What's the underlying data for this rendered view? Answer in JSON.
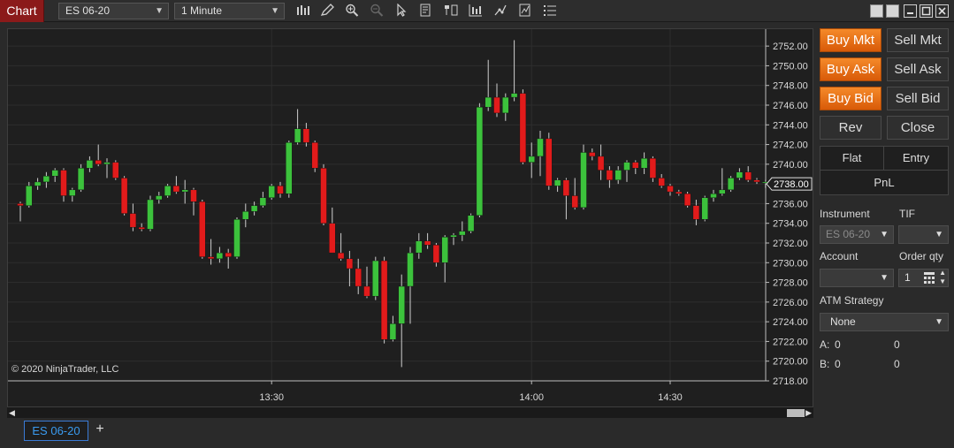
{
  "toolbar": {
    "tab_label": "Chart",
    "instrument": "ES 06-20",
    "interval": "1 Minute",
    "tools": [
      "bar-type-icon",
      "drawing-pencil-icon",
      "zoom-in-icon",
      "zoom-out-icon",
      "pointer-icon",
      "data-box-icon",
      "indicators-icon",
      "strategies-icon",
      "properties-icon",
      "chart-trader-icon"
    ]
  },
  "chart": {
    "copyright": "© 2020 NinjaTrader, LLC",
    "current_price_label": "2738.00",
    "colors": {
      "up": "#3cc23c",
      "down": "#e21b1b",
      "wick": "#cfcfcf",
      "grid": "#2e2e2e",
      "bg": "#1f1f1f"
    }
  },
  "chart_data": {
    "type": "candlestick",
    "title": "",
    "xlabel": "",
    "ylabel": "",
    "ylim": [
      2718,
      2753
    ],
    "y_ticks": [
      "2752.00",
      "2750.00",
      "2748.00",
      "2746.00",
      "2744.00",
      "2742.00",
      "2740.00",
      "2738.00",
      "2736.00",
      "2734.00",
      "2732.00",
      "2730.00",
      "2728.00",
      "2726.00",
      "2724.00",
      "2722.00",
      "2720.00",
      "2718.00"
    ],
    "x_ticks": [
      {
        "label": "13:30",
        "index": 29
      },
      {
        "label": "14:00",
        "index": 59
      },
      {
        "label": "14:30",
        "index": 75
      }
    ],
    "candles": [
      [
        2736.0,
        2736.2,
        2734.2,
        2735.8
      ],
      [
        2735.8,
        2738.2,
        2735.6,
        2737.8
      ],
      [
        2737.8,
        2738.6,
        2737.4,
        2738.2
      ],
      [
        2738.2,
        2739.2,
        2737.6,
        2738.8
      ],
      [
        2738.8,
        2739.6,
        2738.2,
        2739.4
      ],
      [
        2739.4,
        2739.6,
        2736.2,
        2736.8
      ],
      [
        2736.8,
        2737.6,
        2736.2,
        2737.4
      ],
      [
        2737.4,
        2740.0,
        2737.2,
        2739.6
      ],
      [
        2739.6,
        2740.8,
        2739.2,
        2740.4
      ],
      [
        2740.4,
        2742.0,
        2739.8,
        2740.0
      ],
      [
        2740.0,
        2740.6,
        2738.6,
        2740.2
      ],
      [
        2740.2,
        2740.4,
        2738.4,
        2738.6
      ],
      [
        2738.6,
        2738.8,
        2734.8,
        2735.0
      ],
      [
        2735.0,
        2736.0,
        2733.2,
        2733.6
      ],
      [
        2733.6,
        2734.0,
        2733.2,
        2733.4
      ],
      [
        2733.4,
        2736.8,
        2733.2,
        2736.4
      ],
      [
        2736.4,
        2737.2,
        2736.0,
        2736.8
      ],
      [
        2736.8,
        2738.0,
        2736.6,
        2737.8
      ],
      [
        2737.8,
        2738.8,
        2737.0,
        2737.2
      ],
      [
        2737.2,
        2738.4,
        2736.0,
        2737.4
      ],
      [
        2737.4,
        2737.6,
        2734.8,
        2736.2
      ],
      [
        2736.2,
        2736.4,
        2730.4,
        2730.6
      ],
      [
        2730.6,
        2732.4,
        2729.8,
        2730.4
      ],
      [
        2730.4,
        2731.6,
        2730.0,
        2731.0
      ],
      [
        2731.0,
        2731.4,
        2729.4,
        2730.6
      ],
      [
        2730.6,
        2734.6,
        2730.4,
        2734.4
      ],
      [
        2734.4,
        2736.0,
        2733.6,
        2735.2
      ],
      [
        2735.2,
        2736.2,
        2734.8,
        2735.8
      ],
      [
        2735.8,
        2737.2,
        2735.6,
        2736.6
      ],
      [
        2736.6,
        2738.0,
        2736.4,
        2737.8
      ],
      [
        2737.8,
        2738.2,
        2736.6,
        2737.0
      ],
      [
        2737.0,
        2742.4,
        2736.6,
        2742.2
      ],
      [
        2742.2,
        2745.6,
        2742.0,
        2743.6
      ],
      [
        2743.6,
        2744.2,
        2741.8,
        2742.2
      ],
      [
        2742.2,
        2742.4,
        2739.2,
        2739.6
      ],
      [
        2739.6,
        2740.0,
        2733.8,
        2734.0
      ],
      [
        2734.0,
        2735.6,
        2731.0,
        2731.0
      ],
      [
        2731.0,
        2733.0,
        2730.2,
        2730.4
      ],
      [
        2730.4,
        2731.2,
        2727.6,
        2729.4
      ],
      [
        2729.4,
        2730.4,
        2726.8,
        2727.6
      ],
      [
        2727.6,
        2729.6,
        2726.4,
        2726.6
      ],
      [
        2726.6,
        2730.6,
        2726.2,
        2730.2
      ],
      [
        2730.2,
        2730.6,
        2721.8,
        2722.2
      ],
      [
        2722.2,
        2724.6,
        2722.0,
        2723.8
      ],
      [
        2723.8,
        2728.8,
        2719.4,
        2727.6
      ],
      [
        2727.6,
        2731.6,
        2723.8,
        2731.0
      ],
      [
        2731.0,
        2733.0,
        2730.4,
        2732.2
      ],
      [
        2732.2,
        2733.0,
        2731.4,
        2731.8
      ],
      [
        2731.8,
        2732.0,
        2729.6,
        2730.0
      ],
      [
        2730.0,
        2732.8,
        2728.0,
        2732.6
      ],
      [
        2732.6,
        2733.0,
        2731.8,
        2732.8
      ],
      [
        2732.8,
        2734.2,
        2732.2,
        2733.2
      ],
      [
        2733.2,
        2735.0,
        2733.0,
        2734.8
      ],
      [
        2734.8,
        2746.2,
        2734.6,
        2745.8
      ],
      [
        2745.8,
        2750.6,
        2745.4,
        2746.8
      ],
      [
        2746.8,
        2748.2,
        2744.8,
        2745.2
      ],
      [
        2745.2,
        2747.2,
        2744.4,
        2746.8
      ],
      [
        2746.8,
        2752.6,
        2746.4,
        2747.2
      ],
      [
        2747.2,
        2747.6,
        2740.0,
        2740.2
      ],
      [
        2740.2,
        2742.2,
        2738.6,
        2740.8
      ],
      [
        2740.8,
        2743.4,
        2738.8,
        2742.6
      ],
      [
        2742.6,
        2743.2,
        2737.4,
        2737.8
      ],
      [
        2737.8,
        2738.6,
        2737.2,
        2738.4
      ],
      [
        2738.4,
        2738.6,
        2734.4,
        2736.8
      ],
      [
        2736.8,
        2738.6,
        2735.4,
        2735.6
      ],
      [
        2735.6,
        2742.0,
        2735.4,
        2741.2
      ],
      [
        2741.2,
        2741.6,
        2740.4,
        2740.8
      ],
      [
        2740.8,
        2742.0,
        2738.4,
        2739.4
      ],
      [
        2739.4,
        2739.8,
        2737.6,
        2738.4
      ],
      [
        2738.4,
        2739.8,
        2738.0,
        2739.4
      ],
      [
        2739.4,
        2740.4,
        2738.2,
        2740.2
      ],
      [
        2740.2,
        2740.4,
        2739.0,
        2739.6
      ],
      [
        2739.6,
        2741.2,
        2739.0,
        2740.6
      ],
      [
        2740.6,
        2740.8,
        2738.2,
        2738.6
      ],
      [
        2738.6,
        2739.0,
        2737.6,
        2737.8
      ],
      [
        2737.8,
        2738.0,
        2736.8,
        2737.2
      ],
      [
        2737.2,
        2737.4,
        2736.8,
        2737.0
      ],
      [
        2737.0,
        2737.2,
        2735.6,
        2735.8
      ],
      [
        2735.8,
        2736.4,
        2733.8,
        2734.4
      ],
      [
        2734.4,
        2736.8,
        2734.2,
        2736.6
      ],
      [
        2736.6,
        2737.4,
        2736.2,
        2737.0
      ],
      [
        2737.0,
        2739.6,
        2736.8,
        2737.4
      ],
      [
        2737.4,
        2738.8,
        2737.2,
        2738.6
      ],
      [
        2738.6,
        2739.6,
        2738.4,
        2739.2
      ],
      [
        2739.2,
        2739.8,
        2738.2,
        2738.4
      ],
      [
        2738.4,
        2738.6,
        2738.0,
        2738.2
      ],
      [
        2738.2,
        2738.4,
        2737.6,
        2738.2
      ],
      [
        2738.2,
        2738.4,
        2737.6,
        2738.0
      ]
    ]
  },
  "panel": {
    "buy_mkt": "Buy Mkt",
    "sell_mkt": "Sell Mkt",
    "buy_ask": "Buy Ask",
    "sell_ask": "Sell Ask",
    "buy_bid": "Buy Bid",
    "sell_bid": "Sell Bid",
    "rev": "Rev",
    "close": "Close",
    "flat": "Flat",
    "entry": "Entry",
    "pnl": "PnL",
    "instrument_label": "Instrument",
    "tif_label": "TIF",
    "instrument_value": "ES 06-20",
    "tif_value": "",
    "account_label": "Account",
    "order_qty_label": "Order qty",
    "account_value": "",
    "order_qty_value": "1",
    "atm_label": "ATM Strategy",
    "atm_value": "None",
    "a_label": "A:",
    "a_val1": "0",
    "a_val2": "0",
    "b_label": "B:",
    "b_val1": "0",
    "b_val2": "0"
  },
  "tabs": {
    "doc_tab": "ES 06-20",
    "add": "+"
  }
}
